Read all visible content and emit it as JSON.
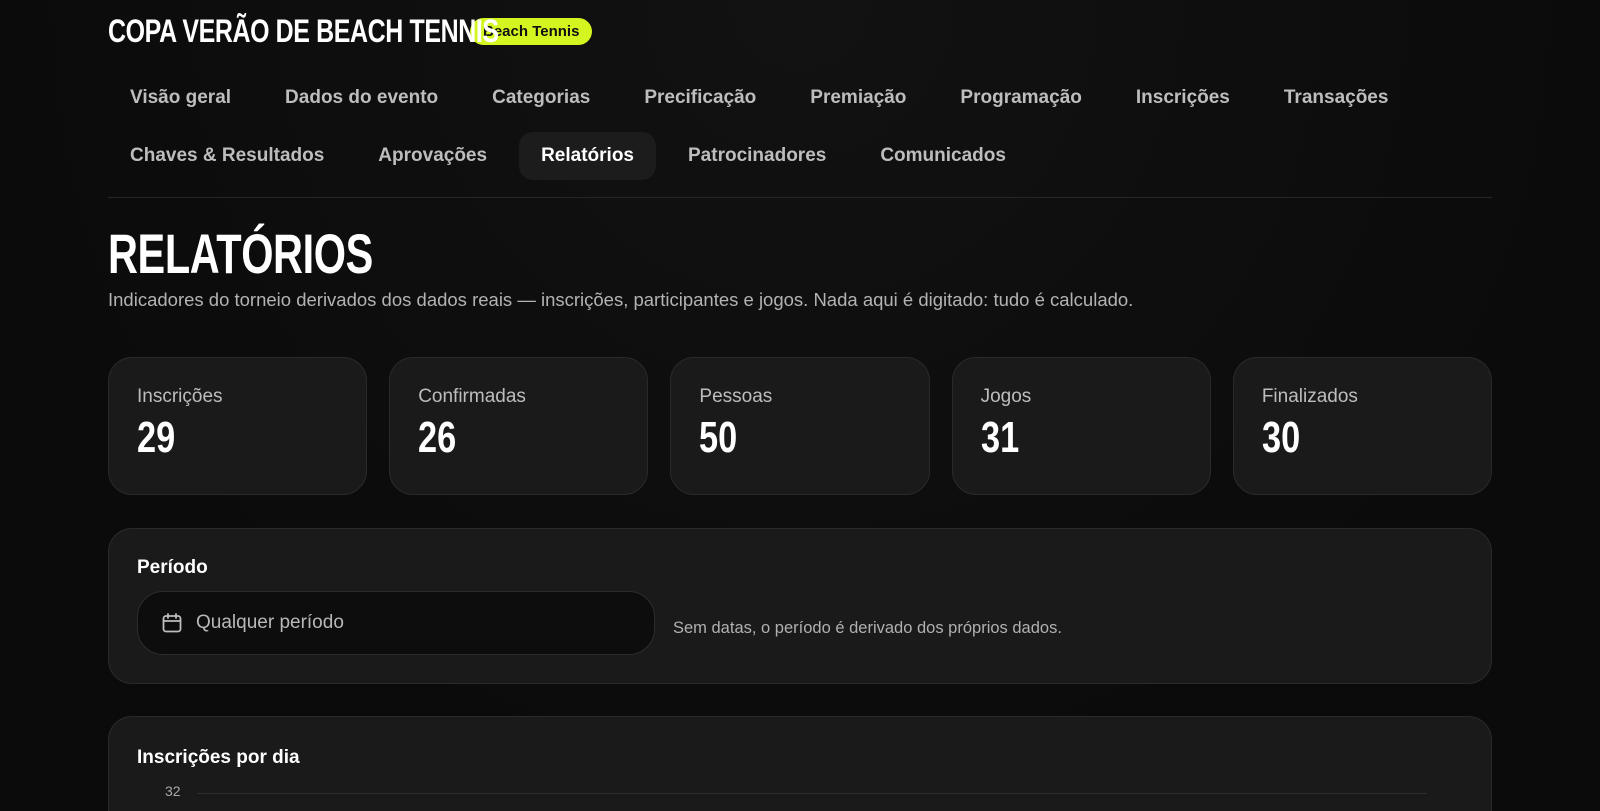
{
  "header": {
    "event_title": "COPA VERÃO DE BEACH TENNIS",
    "sport_badge": "Beach Tennis",
    "accent_color": "#d4f51f"
  },
  "tabs": [
    {
      "label": "Visão geral",
      "active": false
    },
    {
      "label": "Dados do evento",
      "active": false
    },
    {
      "label": "Categorias",
      "active": false
    },
    {
      "label": "Precificação",
      "active": false
    },
    {
      "label": "Premiação",
      "active": false
    },
    {
      "label": "Programação",
      "active": false
    },
    {
      "label": "Inscrições",
      "active": false
    },
    {
      "label": "Transações",
      "active": false
    },
    {
      "label": "Chaves & Resultados",
      "active": false
    },
    {
      "label": "Aprovações",
      "active": false
    },
    {
      "label": "Relatórios",
      "active": true
    },
    {
      "label": "Patrocinadores",
      "active": false
    },
    {
      "label": "Comunicados",
      "active": false
    }
  ],
  "page": {
    "title": "RELATÓRIOS",
    "subtitle": "Indicadores do torneio derivados dos dados reais — inscrições, participantes e jogos. Nada aqui é digitado: tudo é calculado."
  },
  "stats": [
    {
      "label": "Inscrições",
      "value": "29"
    },
    {
      "label": "Confirmadas",
      "value": "26"
    },
    {
      "label": "Pessoas",
      "value": "50"
    },
    {
      "label": "Jogos",
      "value": "31"
    },
    {
      "label": "Finalizados",
      "value": "30"
    }
  ],
  "period": {
    "title": "Período",
    "icon": "calendar-icon",
    "value": "Qualquer período",
    "hint": "Sem datas, o período é derivado dos próprios dados."
  },
  "chart": {
    "title": "Inscrições por dia",
    "y_top_tick": "32"
  }
}
